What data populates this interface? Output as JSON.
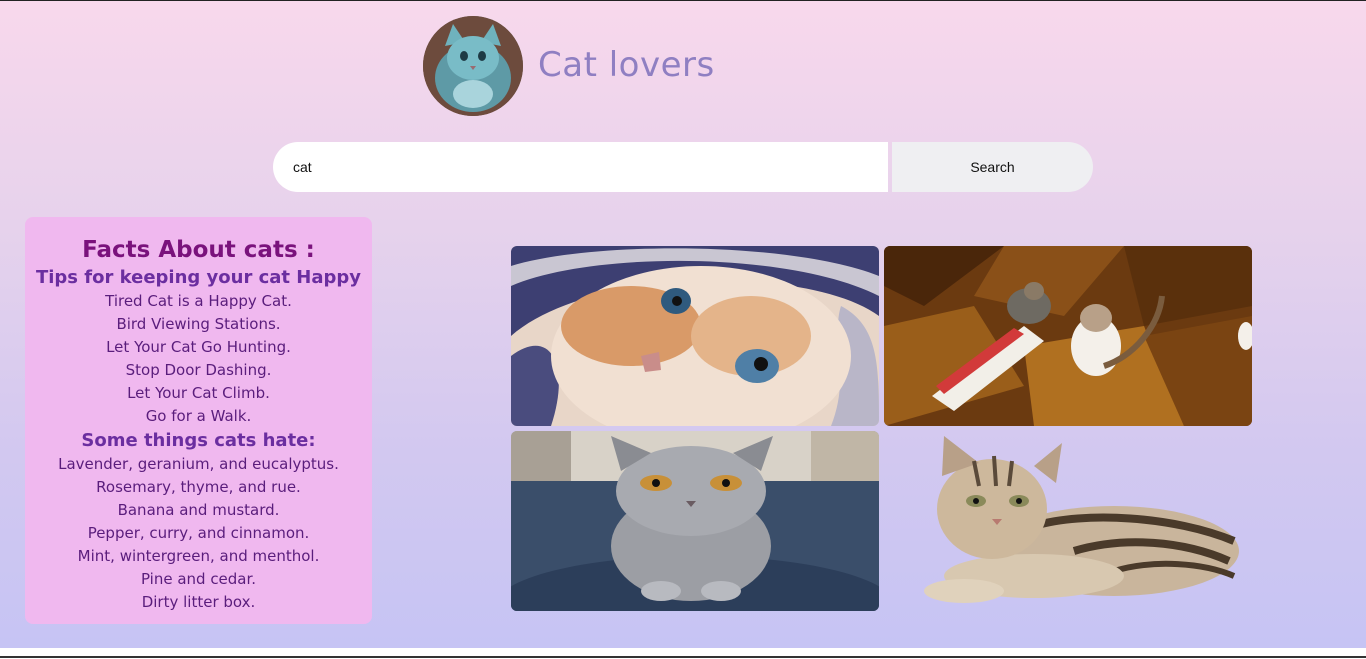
{
  "header": {
    "logo_icon": "cat-photo-avatar",
    "title": "Cat lovers"
  },
  "search": {
    "value": "cat",
    "button_label": "Search"
  },
  "facts": {
    "title": "Facts About cats :",
    "tips_heading": "Tips for keeping your cat Happy",
    "tips": [
      "Tired Cat is a Happy Cat.",
      "Bird Viewing Stations.",
      "Let Your Cat Go Hunting.",
      "Stop Door Dashing.",
      "Let Your Cat Climb.",
      "Go for a Walk."
    ],
    "hate_heading": "Some things cats hate:",
    "hates": [
      "Lavender, geranium, and eucalyptus.",
      "Rosemary, thyme, and rue.",
      "Banana and mustard.",
      "Pepper, curry, and cinnamon.",
      "Mint, wintergreen, and menthol.",
      "Pine and cedar.",
      "Dirty litter box."
    ]
  },
  "gallery": {
    "images": [
      {
        "icon": "kitten-in-hood-photo"
      },
      {
        "icon": "two-cats-on-floor-photo"
      },
      {
        "icon": "grey-kitten-photo"
      },
      {
        "icon": "tabby-kitten-lying-photo"
      }
    ]
  },
  "colors": {
    "title": "#8f7fc2",
    "facts_bg": "#f0b8ef",
    "facts_title": "#7a127c",
    "facts_heading": "#6b2ea0",
    "facts_text": "#5a1d7c",
    "background_top": "#f8d8ec",
    "background_bottom": "#c6c4f4"
  }
}
